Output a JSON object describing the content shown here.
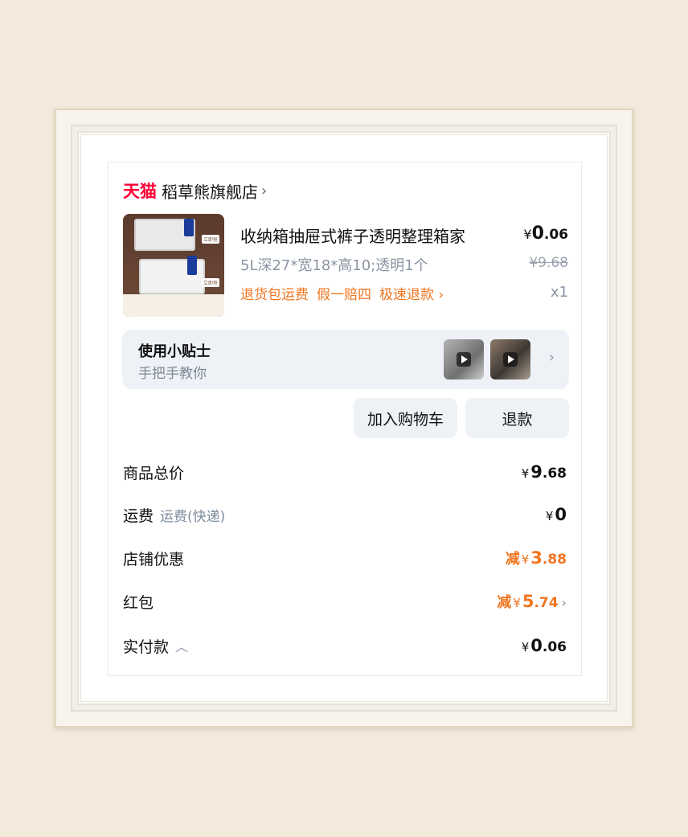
{
  "shop": {
    "logo_text": "天猫",
    "name": "稻草熊旗舰店",
    "chevron": "›"
  },
  "product": {
    "title": "收纳箱抽屉式裤子透明整理箱家",
    "price_symbol": "¥",
    "price_int": "0",
    "price_dec": ".06",
    "spec": "5L深27*宽18*高10;透明1个",
    "original_price": "¥9.68",
    "services": [
      "退货包运费",
      "假一赔四",
      "极速退款 ›"
    ],
    "quantity": "x1",
    "thumb_tags": [
      "立即抢",
      "立即抢"
    ]
  },
  "tips": {
    "title": "使用小贴士",
    "subtitle": "手把手教你",
    "chevron": "›"
  },
  "buttons": {
    "add_cart": "加入购物车",
    "refund": "退款"
  },
  "summary": {
    "goods_total_label": "商品总价",
    "goods_total_sym": "¥",
    "goods_total_int": "9",
    "goods_total_dec": ".68",
    "shipping_label": "运费",
    "shipping_sub": "运费(快递)",
    "shipping_sym": "¥",
    "shipping_val": "0",
    "store_discount_label": "店铺优惠",
    "store_discount_prefix": "减",
    "store_discount_sym": "¥",
    "store_discount_int": "3",
    "store_discount_dec": ".88",
    "red_packet_label": "红包",
    "red_packet_prefix": "减",
    "red_packet_sym": "¥",
    "red_packet_int": "5",
    "red_packet_dec": ".74",
    "red_packet_chevron": "›",
    "paid_label": "实付款",
    "paid_caret": "︿",
    "paid_sym": "¥",
    "paid_int": "0",
    "paid_dec": ".06"
  },
  "colors": {
    "tmall_red": "#ff0036",
    "accent_orange": "#f07520",
    "muted_gray": "#8a94a3",
    "card_bg": "#eef2f7"
  }
}
